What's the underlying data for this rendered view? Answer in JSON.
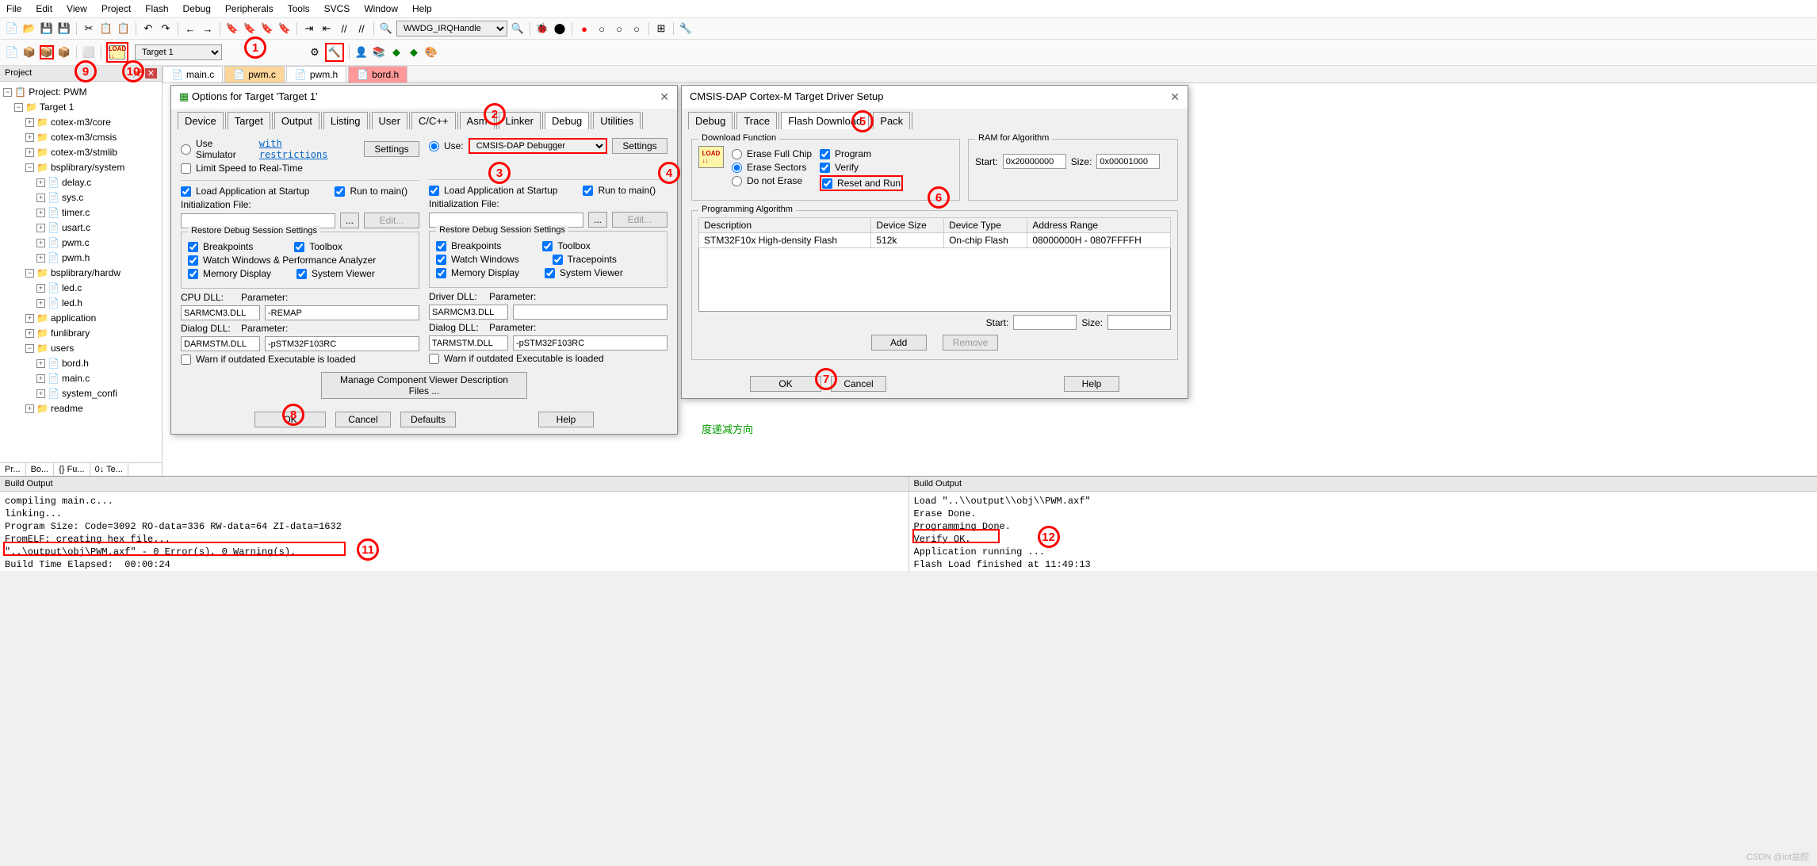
{
  "menu": [
    "File",
    "Edit",
    "View",
    "Project",
    "Flash",
    "Debug",
    "Peripherals",
    "Tools",
    "SVCS",
    "Window",
    "Help"
  ],
  "toolbar_combo": "WWDG_IRQHandle",
  "target_combo": "Target 1",
  "project_panel_title": "Project",
  "project_tabs": [
    "Pr...",
    "Bo...",
    "{} Fu...",
    "0↓ Te..."
  ],
  "tree": {
    "root": "Project: PWM",
    "target": "Target 1",
    "groups": [
      {
        "name": "cotex-m3/core",
        "files": []
      },
      {
        "name": "cotex-m3/cmsis",
        "files": []
      },
      {
        "name": "cotex-m3/stmlib",
        "files": []
      },
      {
        "name": "bsplibrary/system",
        "files": [
          "delay.c",
          "sys.c",
          "timer.c",
          "usart.c",
          "pwm.c",
          "pwm.h"
        ],
        "open": true
      },
      {
        "name": "bsplibrary/hardw",
        "files": [
          "led.c",
          "led.h"
        ],
        "open": true
      },
      {
        "name": "application",
        "files": []
      },
      {
        "name": "funlibrary",
        "files": []
      },
      {
        "name": "users",
        "files": [
          "bord.h",
          "main.c",
          "system_confi"
        ],
        "open": true
      },
      {
        "name": "readme",
        "files": []
      }
    ]
  },
  "file_tabs": [
    {
      "name": "main.c",
      "cls": ""
    },
    {
      "name": "pwm.c",
      "cls": "active"
    },
    {
      "name": "pwm.h",
      "cls": ""
    },
    {
      "name": "bord.h",
      "cls": "red"
    }
  ],
  "options_dialog": {
    "title": "Options for Target 'Target 1'",
    "tabs": [
      "Device",
      "Target",
      "Output",
      "Listing",
      "User",
      "C/C++",
      "Asm",
      "Linker",
      "Debug",
      "Utilities"
    ],
    "active_tab": "Debug",
    "left": {
      "use_sim": "Use Simulator",
      "restrictions": "with restrictions",
      "settings": "Settings",
      "limit_speed": "Limit Speed to Real-Time",
      "load_app": "Load Application at Startup",
      "run_main": "Run to main()",
      "init_file": "Initialization File:",
      "edit": "Edit...",
      "restore": "Restore Debug Session Settings",
      "breakpoints": "Breakpoints",
      "toolbox": "Toolbox",
      "watch_perf": "Watch Windows & Performance Analyzer",
      "mem_disp": "Memory Display",
      "sys_viewer": "System Viewer",
      "cpu_dll": "CPU DLL:",
      "cpu_dll_v": "SARMCM3.DLL",
      "param": "Parameter:",
      "param_v": "-REMAP",
      "dialog_dll": "Dialog DLL:",
      "dialog_dll_v": "DARMSTM.DLL",
      "dparam_v": "-pSTM32F103RC",
      "warn": "Warn if outdated Executable is loaded"
    },
    "right": {
      "use": "Use:",
      "debugger": "CMSIS-DAP Debugger",
      "settings": "Settings",
      "load_app": "Load Application at Startup",
      "run_main": "Run to main()",
      "init_file": "Initialization File:",
      "edit": "Edit...",
      "restore": "Restore Debug Session Settings",
      "breakpoints": "Breakpoints",
      "toolbox": "Toolbox",
      "watch": "Watch Windows",
      "trace": "Tracepoints",
      "mem_disp": "Memory Display",
      "sys_viewer": "System Viewer",
      "driver_dll": "Driver DLL:",
      "driver_dll_v": "SARMCM3.DLL",
      "param": "Parameter:",
      "dialog_dll": "Dialog DLL:",
      "dialog_dll_v": "TARMSTM.DLL",
      "dparam_v": "-pSTM32F103RC",
      "warn": "Warn if outdated Executable is loaded"
    },
    "manage": "Manage Component Viewer Description Files ...",
    "ok": "OK",
    "cancel": "Cancel",
    "defaults": "Defaults",
    "help": "Help"
  },
  "driver_dialog": {
    "title": "CMSIS-DAP Cortex-M Target Driver Setup",
    "tabs": [
      "Debug",
      "Trace",
      "Flash Download",
      "Pack"
    ],
    "active_tab": "Flash Download",
    "download_func": "Download Function",
    "erase_full": "Erase Full Chip",
    "erase_sectors": "Erase Sectors",
    "do_not_erase": "Do not Erase",
    "program": "Program",
    "verify": "Verify",
    "reset_run": "Reset and Run",
    "ram": "RAM for Algorithm",
    "start": "Start:",
    "start_v": "0x20000000",
    "size": "Size:",
    "size_v": "0x00001000",
    "prog_algo": "Programming Algorithm",
    "cols": [
      "Description",
      "Device Size",
      "Device Type",
      "Address Range"
    ],
    "row": [
      "STM32F10x High-density Flash",
      "512k",
      "On-chip Flash",
      "08000000H - 0807FFFFH"
    ],
    "start2": "Start:",
    "size2": "Size:",
    "add": "Add",
    "remove": "Remove",
    "ok": "OK",
    "cancel": "Cancel",
    "help": "Help"
  },
  "green_text": "度递减方向",
  "output_title": "Build Output",
  "output_left": "compiling main.c...\nlinking...\nProgram Size: Code=3092 RO-data=336 RW-data=64 ZI-data=1632\nFromELF: creating hex file...\n\"..\\output\\obj\\PWM.axf\" - 0 Error(s), 0 Warning(s).\nBuild Time Elapsed:  00:00:24",
  "output_right": "Load \"..\\\\output\\\\obj\\\\PWM.axf\"\nErase Done.\nProgramming Done.\nVerify OK.\nApplication running ...\nFlash Load finished at 11:49:13",
  "watermark": "CSDN @iot盆腔"
}
